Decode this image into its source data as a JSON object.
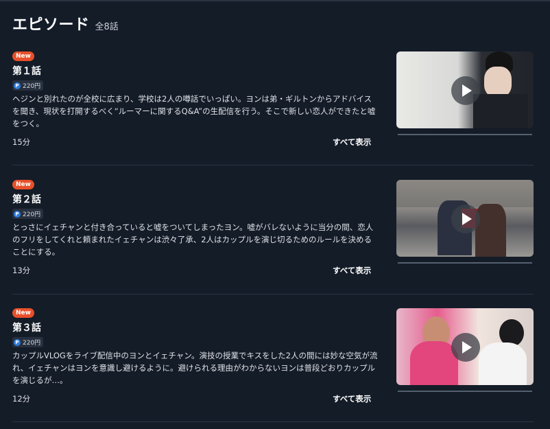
{
  "header": {
    "title": "エピソード",
    "count": "全8話"
  },
  "episodes": [
    {
      "badge": "New",
      "title": "第１話",
      "price_icon": "P",
      "price": "220円",
      "description": "ヘジンと別れたのが全校に広まり、学校は2人の噂話でいっぱい。ヨンは弟・ギルトンからアドバイスを聞き、現状を打開するべく“ルーマーに関するQ&A”の生配信を行う。そこで新しい恋人ができたと嘘をつく。",
      "duration": "15分",
      "show_all": "すべて表示"
    },
    {
      "badge": "New",
      "title": "第２話",
      "price_icon": "P",
      "price": "220円",
      "description": "とっさにイェチャンと付き合っていると嘘をついてしまったヨン。嘘がバレないように当分の間、恋人のフリをしてくれと頼まれたイェチャンは渋々了承、2人はカップルを演じ切るためのルールを決めることにする。",
      "duration": "13分",
      "show_all": "すべて表示"
    },
    {
      "badge": "New",
      "title": "第３話",
      "price_icon": "P",
      "price": "220円",
      "description": "カップルVLOGをライブ配信中のヨンとイェチャン。演技の授業でキスをした2人の間には妙な空気が流れ、イェチャンはヨンを意識し避けるように。避けられる理由がわからないヨンは普段どおりカップルを演じるが…。",
      "duration": "12分",
      "show_all": "すべて表示"
    }
  ],
  "colors": {
    "background": "#141c28",
    "badge": "#e8502a",
    "point_icon": "#2f7de1"
  }
}
